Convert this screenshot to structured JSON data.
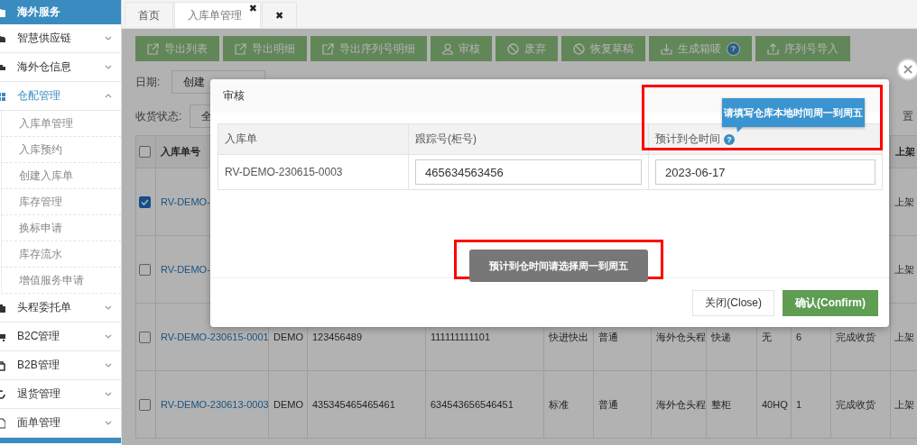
{
  "sidebar": {
    "items": [
      {
        "label": "海外服务",
        "kind": "header"
      },
      {
        "label": "智慧供应链",
        "kind": "menu",
        "expanded": false
      },
      {
        "label": "海外仓信息",
        "kind": "menu",
        "expanded": false
      },
      {
        "label": "仓配管理",
        "kind": "menu",
        "expanded": true,
        "children": [
          {
            "label": "入库单管理"
          },
          {
            "label": "入库预约"
          },
          {
            "label": "创建入库单"
          },
          {
            "label": "库存管理"
          },
          {
            "label": "换标申请"
          },
          {
            "label": "库存流水"
          },
          {
            "label": "增值服务申请"
          }
        ]
      },
      {
        "label": "头程委托单",
        "kind": "menu",
        "expanded": false
      },
      {
        "label": "B2C管理",
        "kind": "menu",
        "expanded": false
      },
      {
        "label": "B2B管理",
        "kind": "menu",
        "expanded": false
      },
      {
        "label": "退货管理",
        "kind": "menu",
        "expanded": false
      },
      {
        "label": "面单管理",
        "kind": "menu",
        "expanded": false
      }
    ]
  },
  "tabs": [
    {
      "label": "首页",
      "selected": false
    },
    {
      "label": "入库单管理",
      "selected": true,
      "close": "✖"
    },
    {
      "label": "✖",
      "selected": false
    }
  ],
  "toolbar": {
    "buttons": [
      {
        "label": "导出列表"
      },
      {
        "label": "导出明细"
      },
      {
        "label": "导出序列号明细"
      },
      {
        "label": "审核"
      },
      {
        "label": "废弃"
      },
      {
        "label": "恢复草稿"
      },
      {
        "label": "生成箱唛",
        "help": "?"
      },
      {
        "label": "序列号导入"
      }
    ]
  },
  "filters": [
    {
      "label": "日期:",
      "value": "创建"
    },
    {
      "label": "收货状态:",
      "value": "全",
      "row_end": "置"
    }
  ],
  "table": {
    "header": {
      "checked": false,
      "order_no": "入库单号",
      "column_12": "上架"
    },
    "rows": [
      {
        "selected": true,
        "order_no": "RV-DEMO-",
        "column_12": "上架"
      },
      {
        "selected": false,
        "order_no": "RV-DEMO-",
        "column_12": "上架"
      },
      {
        "selected": false,
        "order_no": "RV-DEMO-230615-0001",
        "cells": [
          "DEMO",
          "123456489",
          "111111111101",
          "快进快出",
          "普通",
          "海外仓头程",
          "快递",
          "无",
          "6",
          "完成收货"
        ],
        "column_12": "上架"
      },
      {
        "selected": false,
        "order_no": "RV-DEMO-230613-0003",
        "cells": [
          "DEMO",
          "435345465465461",
          "634543656546451",
          "标准",
          "普通",
          "海外仓头程",
          "整柜",
          "40HQ",
          "1",
          "完成收货"
        ],
        "column_12": "上架"
      }
    ]
  },
  "modal": {
    "title": "审核",
    "columns": [
      {
        "label": "入库单"
      },
      {
        "label": "跟踪号(柜号)"
      },
      {
        "label": "预计到仓时间",
        "help": "?"
      }
    ],
    "row": {
      "order": "RV-DEMO-230615-0003",
      "tracking": "465634563456",
      "eta": "2023-06-17"
    },
    "tooltip": {
      "text": "请填写仓库本地时间周一到周五",
      "highlighted": true
    },
    "toast": {
      "text": "预计到仓时间请选择周一到周五",
      "highlighted": true
    },
    "buttons": [
      {
        "label": "关闭(Close)",
        "kind": "default"
      },
      {
        "label": "确认(Confirm)",
        "kind": "primary"
      }
    ]
  }
}
